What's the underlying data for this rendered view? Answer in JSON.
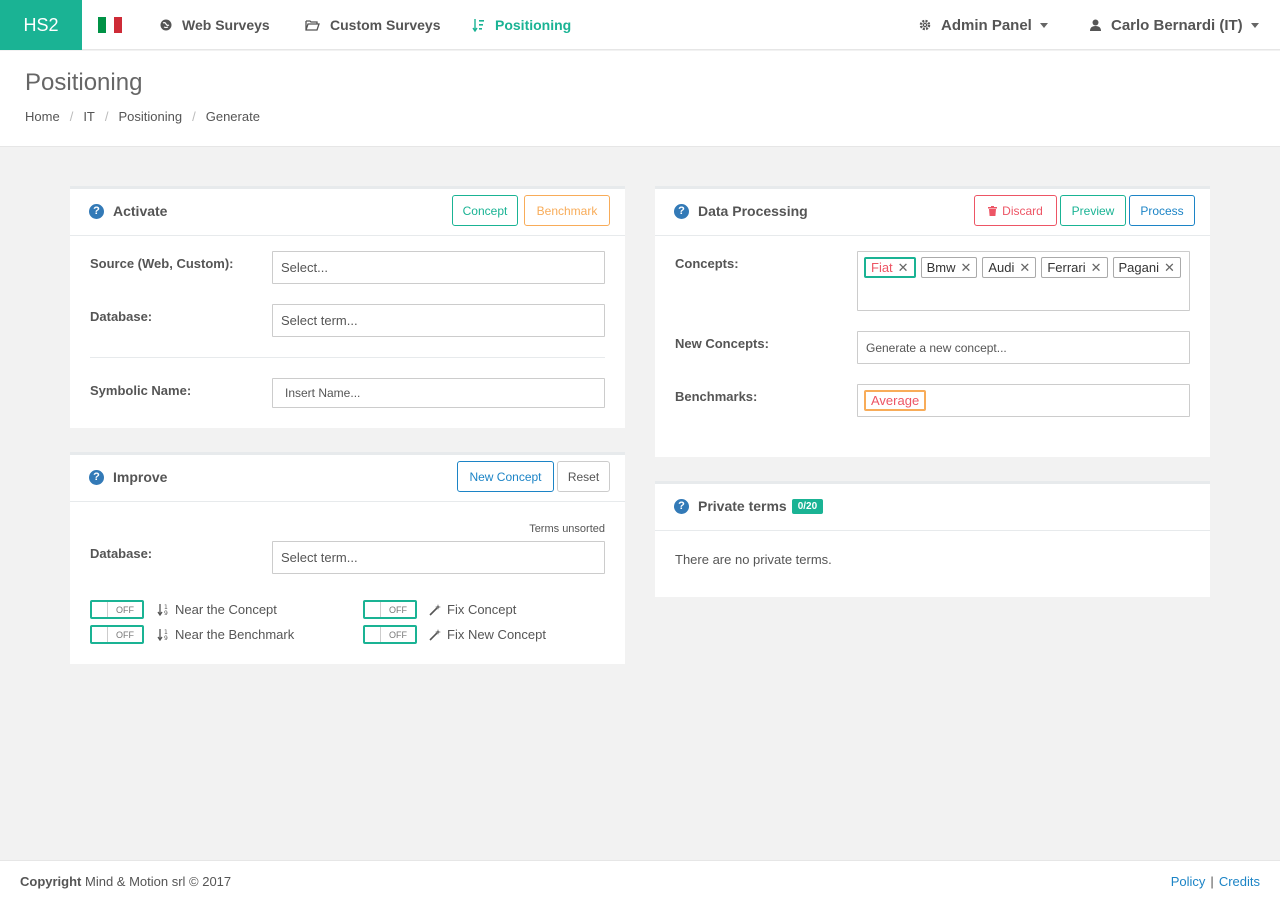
{
  "nav": {
    "brand": "HS2",
    "web_surveys": "Web Surveys",
    "custom_surveys": "Custom Surveys",
    "positioning": "Positioning",
    "admin_panel": "Admin Panel",
    "user": "Carlo Bernardi (IT)",
    "icons": {
      "web": "globe-icon",
      "custom": "folder-open-icon",
      "positioning": "sort-numeric-icon",
      "admin": "gear-icon",
      "user": "user-icon"
    },
    "flag_colors": [
      "#009246",
      "#ffffff",
      "#ce2b37"
    ]
  },
  "header": {
    "title": "Positioning",
    "breadcrumb": [
      "Home",
      "IT",
      "Positioning",
      "Generate"
    ]
  },
  "activate": {
    "title": "Activate",
    "concept_btn": "Concept",
    "benchmark_btn": "Benchmark",
    "source_label": "Source (Web, Custom):",
    "source_placeholder": "Select...",
    "database_label": "Database:",
    "database_placeholder": "Select term...",
    "symbolic_label": "Symbolic Name:",
    "symbolic_placeholder": "Insert Name..."
  },
  "improve": {
    "title": "Improve",
    "new_concept_btn": "New Concept",
    "reset_btn": "Reset",
    "terms_unsorted": "Terms unsorted",
    "database_label": "Database:",
    "database_placeholder": "Select term...",
    "toggle_off": "OFF",
    "near_concept": "Near the Concept",
    "near_benchmark": "Near the Benchmark",
    "fix_concept": "Fix Concept",
    "fix_new_concept": "Fix New Concept"
  },
  "data_processing": {
    "title": "Data Processing",
    "discard_btn": "Discard",
    "preview_btn": "Preview",
    "process_btn": "Process",
    "concepts_label": "Concepts:",
    "concepts": [
      "Fiat",
      "Bmw",
      "Audi",
      "Ferrari",
      "Pagani"
    ],
    "new_concepts_label": "New Concepts:",
    "new_concepts_placeholder": "Generate a new concept...",
    "benchmarks_label": "Benchmarks:",
    "benchmark": "Average"
  },
  "private_terms": {
    "title": "Private terms",
    "badge": "0/20",
    "empty": "There are no private terms."
  },
  "footer": {
    "copyright_bold": "Copyright",
    "copyright_rest": " Mind & Motion srl © 2017",
    "policy": "Policy",
    "credits": "Credits"
  },
  "colors": {
    "accent": "#1ab394",
    "danger": "#ed5565",
    "warning": "#f8ac59",
    "info": "#1c84c6"
  }
}
